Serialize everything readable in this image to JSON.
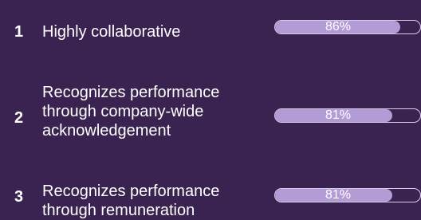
{
  "chart_data": {
    "type": "bar",
    "categories": [
      "Highly collaborative",
      "Recognizes performance through company-wide acknowledgement",
      "Recognizes performance through remuneration"
    ],
    "values": [
      86,
      81,
      81
    ],
    "xlim": [
      0,
      100
    ],
    "ranks": [
      "1",
      "2",
      "3"
    ],
    "labels": [
      [
        "Highly collaborative"
      ],
      [
        "Recognizes performance",
        "through company-wide",
        "acknowledgement"
      ],
      [
        "Recognizes performance",
        "through remuneration"
      ]
    ],
    "value_labels": [
      "86%",
      "81%",
      "81%"
    ],
    "colors": {
      "background": "#3a2350",
      "bar_fill": "#b39bd6",
      "bar_track_border": "#d9cdea",
      "text": "#ffffff"
    }
  }
}
